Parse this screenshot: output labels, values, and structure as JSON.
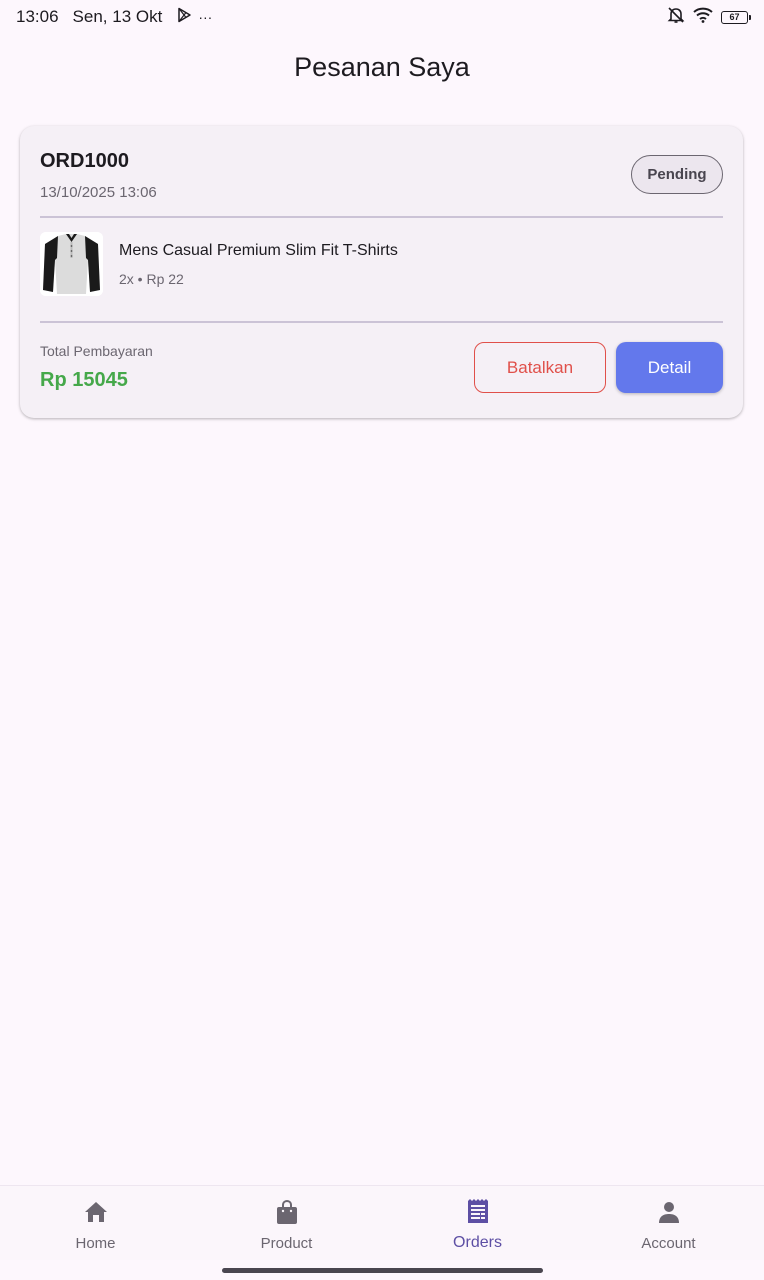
{
  "status_bar": {
    "time": "13:06",
    "date": "Sen, 13 Okt",
    "more": "···",
    "battery": "67",
    "icons": [
      "play-store-icon",
      "bell-off-icon",
      "wifi-icon",
      "battery-icon"
    ]
  },
  "page": {
    "title": "Pesanan Saya"
  },
  "orders": [
    {
      "id": "ORD1000",
      "date": "13/10/2025 13:06",
      "status": "Pending",
      "item": {
        "name": "Mens Casual Premium Slim Fit T-Shirts",
        "meta": "2x • Rp 22",
        "image": "tshirt-image"
      },
      "total_label": "Total Pembayaran",
      "total_value": "Rp 15045",
      "cancel_label": "Batalkan",
      "detail_label": "Detail"
    }
  ],
  "colors": {
    "background": "#fdf7fd",
    "card": "#f5f0f6",
    "accent": "#6378ec",
    "danger": "#e0504a",
    "total": "#45a84a",
    "nav_active": "#5d4fa4"
  },
  "nav": {
    "items": [
      {
        "label": "Home",
        "icon": "home-icon",
        "active": false
      },
      {
        "label": "Product",
        "icon": "shopping-bag-icon",
        "active": false
      },
      {
        "label": "Orders",
        "icon": "receipt-icon",
        "active": true
      },
      {
        "label": "Account",
        "icon": "person-icon",
        "active": false
      }
    ]
  }
}
